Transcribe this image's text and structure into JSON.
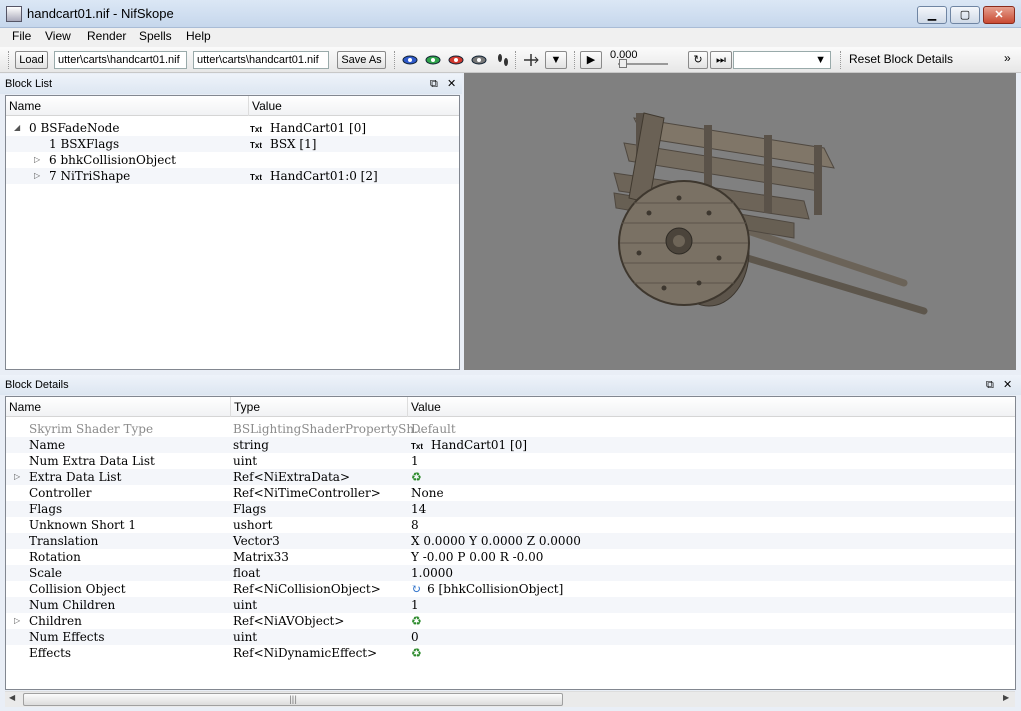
{
  "window": {
    "title": "handcart01.nif - NifSkope"
  },
  "menu": [
    "File",
    "View",
    "Render",
    "Spells",
    "Help"
  ],
  "toolbar": {
    "load_label": "Load",
    "load_path": "utter\\carts\\handcart01.nif",
    "save_path": "utter\\carts\\handcart01.nif",
    "save_as_label": "Save As",
    "time_value": "0.000",
    "reset_label": "Reset Block Details"
  },
  "block_list": {
    "title": "Block List",
    "columns": [
      "Name",
      "Value"
    ],
    "rows": [
      {
        "name": "0 BSFadeNode",
        "value": "HandCart01 [0]",
        "txt": "Txt"
      },
      {
        "name": "1 BSXFlags",
        "value": "BSX [1]",
        "txt": "Txt"
      },
      {
        "name": "6 bhkCollisionObject",
        "value": "",
        "txt": ""
      },
      {
        "name": "7 NiTriShape",
        "value": "HandCart01:0 [2]",
        "txt": "Txt"
      }
    ]
  },
  "block_details": {
    "title": "Block Details",
    "columns": [
      "Name",
      "Type",
      "Value"
    ],
    "rows": [
      {
        "name": "Skyrim Shader Type",
        "type": "BSLightingShaderPropertySh...",
        "value": "Default"
      },
      {
        "name": "Name",
        "type": "string",
        "value": "HandCart01 [0]",
        "txt": "Txt"
      },
      {
        "name": "Num Extra Data List",
        "type": "uint",
        "value": "1"
      },
      {
        "name": "Extra Data List",
        "type": "Ref<NiExtraData>",
        "value": ""
      },
      {
        "name": "Controller",
        "type": "Ref<NiTimeController>",
        "value": "None"
      },
      {
        "name": "Flags",
        "type": "Flags",
        "value": "14"
      },
      {
        "name": "Unknown Short 1",
        "type": "ushort",
        "value": "8"
      },
      {
        "name": "Translation",
        "type": "Vector3",
        "value": "X 0.0000 Y 0.0000 Z 0.0000"
      },
      {
        "name": "Rotation",
        "type": "Matrix33",
        "value": "Y -0.00 P 0.00 R -0.00"
      },
      {
        "name": "Scale",
        "type": "float",
        "value": "1.0000"
      },
      {
        "name": "Collision Object",
        "type": "Ref<NiCollisionObject>",
        "value": "6 [bhkCollisionObject]"
      },
      {
        "name": "Num Children",
        "type": "uint",
        "value": "1"
      },
      {
        "name": "Children",
        "type": "Ref<NiAVObject>",
        "value": ""
      },
      {
        "name": "Num Effects",
        "type": "uint",
        "value": "0"
      },
      {
        "name": "Effects",
        "type": "Ref<NiDynamicEffect>",
        "value": ""
      }
    ]
  },
  "colors": {
    "viewport": "#808080",
    "title_bar": "#c6d7ec",
    "close_button": "#c94a33"
  }
}
